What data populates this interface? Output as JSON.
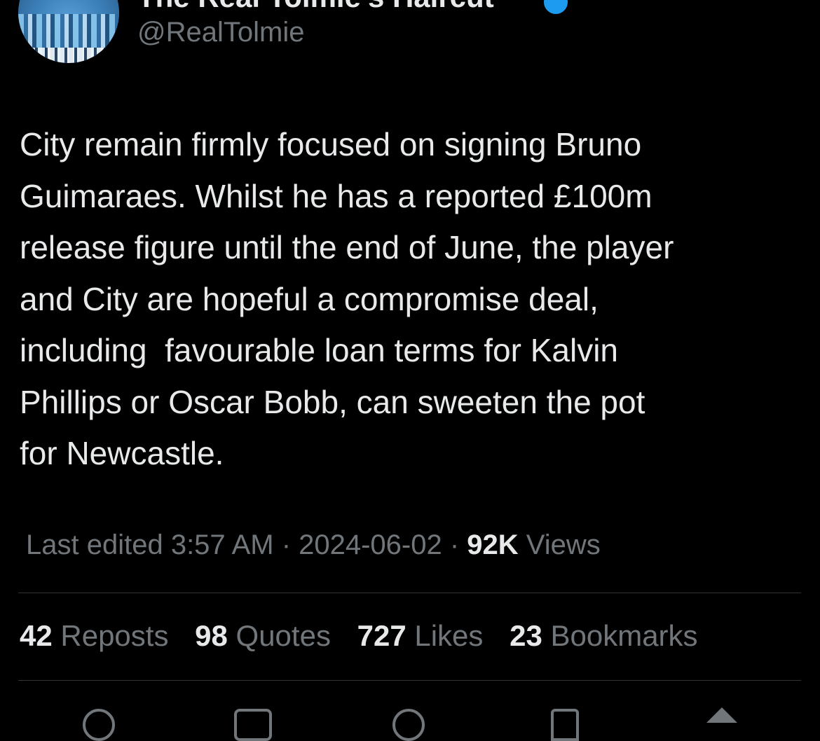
{
  "tweet": {
    "display_name": "The Real Tolmie's Haircut",
    "handle": "@RealTolmie",
    "text": "City remain firmly focused on signing Bruno\nGuimaraes. Whilst he has a reported £100m\nrelease figure until the end of June, the player\nand City are hopeful a compromise deal,\nincluding  favourable loan terms for Kalvin\nPhillips or Oscar Bobb, can sweeten the pot\nfor Newcastle.",
    "meta": {
      "edited_prefix": "Last edited 3:57 AM · 2024-06-02",
      "separator": " ·",
      "views_count": "92K",
      "views_label": " Views"
    },
    "stats": [
      {
        "count": "42",
        "label": " Reposts"
      },
      {
        "count": "98",
        "label": " Quotes"
      },
      {
        "count": "727",
        "label": " Likes"
      },
      {
        "count": "23",
        "label": " Bookmarks"
      }
    ]
  },
  "icons": {
    "verified": "verified-badge-icon",
    "reply": "reply-icon",
    "repost": "repost-icon",
    "like": "like-icon",
    "bookmark": "bookmark-icon",
    "share": "share-icon"
  },
  "colors": {
    "background": "#000000",
    "text_primary": "#e7e9ea",
    "text_secondary": "#71767b",
    "divider": "#2f3336",
    "verified": "#1d9bf0"
  }
}
